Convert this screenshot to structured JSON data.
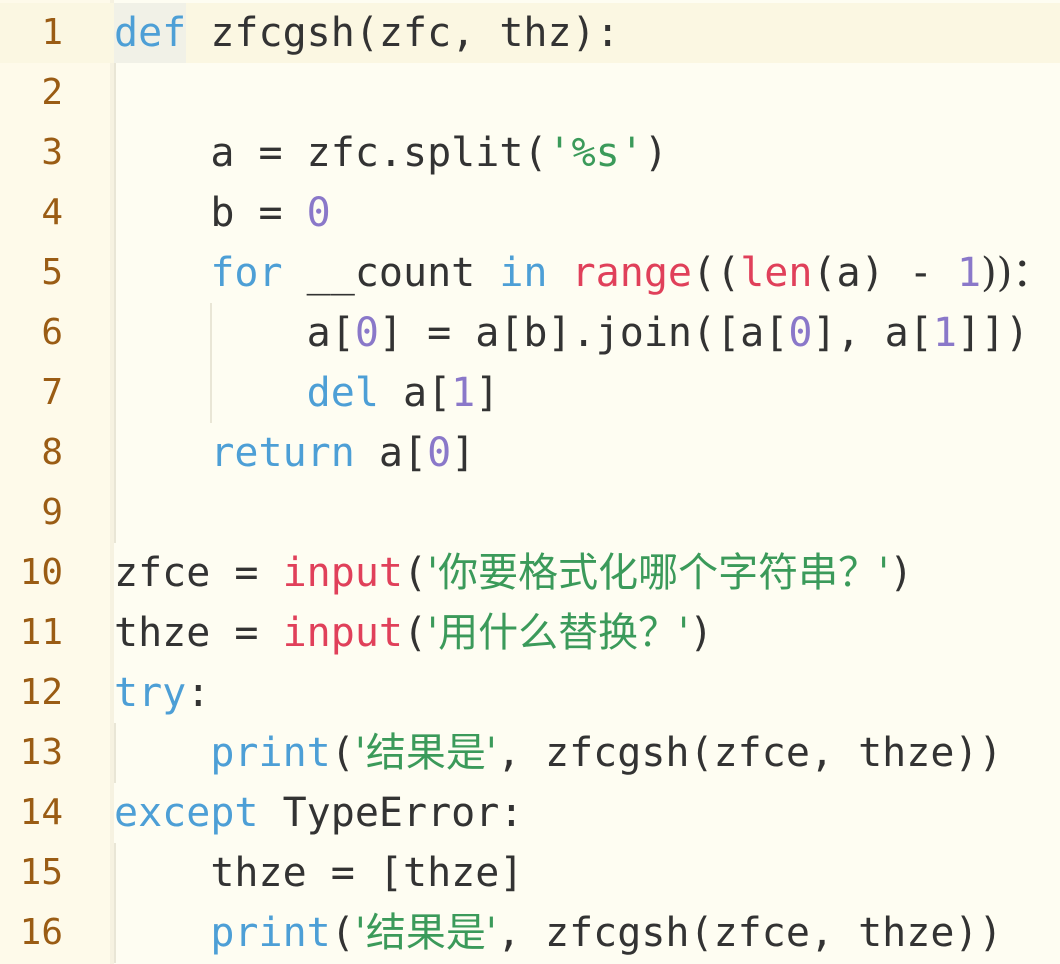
{
  "editor": {
    "active_line": 1,
    "lines": [
      {
        "number": "1",
        "tokens": [
          [
            "kw",
            "def"
          ],
          [
            "p",
            " zfcgsh(zfc, thz):"
          ]
        ]
      },
      {
        "number": "2",
        "tokens": []
      },
      {
        "number": "3",
        "tokens": [
          [
            "p",
            "    a = zfc.split("
          ],
          [
            "str",
            "'%s'"
          ],
          [
            "p",
            ")"
          ]
        ]
      },
      {
        "number": "4",
        "tokens": [
          [
            "p",
            "    b = "
          ],
          [
            "num",
            "0"
          ]
        ]
      },
      {
        "number": "5",
        "tokens": [
          [
            "kw",
            "    for"
          ],
          [
            "p",
            " __count "
          ],
          [
            "kw",
            "in"
          ],
          [
            "p",
            " "
          ],
          [
            "bi",
            "range"
          ],
          [
            "p",
            "(("
          ],
          [
            "bi",
            "len"
          ],
          [
            "p",
            "(a) - "
          ],
          [
            "num",
            "1"
          ],
          [
            "p",
            "))："
          ]
        ]
      },
      {
        "number": "6",
        "tokens": [
          [
            "p",
            "        a["
          ],
          [
            "num",
            "0"
          ],
          [
            "p",
            "] = a[b].join([a["
          ],
          [
            "num",
            "0"
          ],
          [
            "p",
            "], a["
          ],
          [
            "num",
            "1"
          ],
          [
            "p",
            "]])"
          ]
        ]
      },
      {
        "number": "7",
        "tokens": [
          [
            "kw",
            "        del"
          ],
          [
            "p",
            " a["
          ],
          [
            "num",
            "1"
          ],
          [
            "p",
            "]"
          ]
        ]
      },
      {
        "number": "8",
        "tokens": [
          [
            "kw",
            "    return"
          ],
          [
            "p",
            " a["
          ],
          [
            "num",
            "0"
          ],
          [
            "p",
            "]"
          ]
        ]
      },
      {
        "number": "9",
        "tokens": []
      },
      {
        "number": "10",
        "tokens": [
          [
            "p",
            "zfce = "
          ],
          [
            "bi",
            "input"
          ],
          [
            "p",
            "("
          ],
          [
            "str",
            "'你要格式化哪个字符串？'"
          ],
          [
            "p",
            ")"
          ]
        ]
      },
      {
        "number": "11",
        "tokens": [
          [
            "p",
            "thze = "
          ],
          [
            "bi",
            "input"
          ],
          [
            "p",
            "("
          ],
          [
            "str",
            "'用什么替换？'"
          ],
          [
            "p",
            ")"
          ]
        ]
      },
      {
        "number": "12",
        "tokens": [
          [
            "kw",
            "try"
          ],
          [
            "p",
            ":"
          ]
        ]
      },
      {
        "number": "13",
        "tokens": [
          [
            "kw",
            "    print"
          ],
          [
            "p",
            "("
          ],
          [
            "str",
            "'结果是'"
          ],
          [
            "p",
            ", zfcgsh(zfce, thze))"
          ]
        ]
      },
      {
        "number": "14",
        "tokens": [
          [
            "kw",
            "except"
          ],
          [
            "p",
            " TypeError:"
          ]
        ]
      },
      {
        "number": "15",
        "tokens": [
          [
            "p",
            "    thze = [thze]"
          ]
        ]
      },
      {
        "number": "16",
        "tokens": [
          [
            "kw",
            "    print"
          ],
          [
            "p",
            "("
          ],
          [
            "str",
            "'结果是'"
          ],
          [
            "p",
            ", zfcgsh(zfce, thze))"
          ]
        ]
      }
    ]
  },
  "colors": {
    "background": "#fefdf2",
    "line_number": "#9a5c14",
    "keyword": "#4d9fd6",
    "builtin": "#e0405a",
    "number": "#8a78c9",
    "string": "#3b9a5a",
    "plain": "#333333"
  }
}
